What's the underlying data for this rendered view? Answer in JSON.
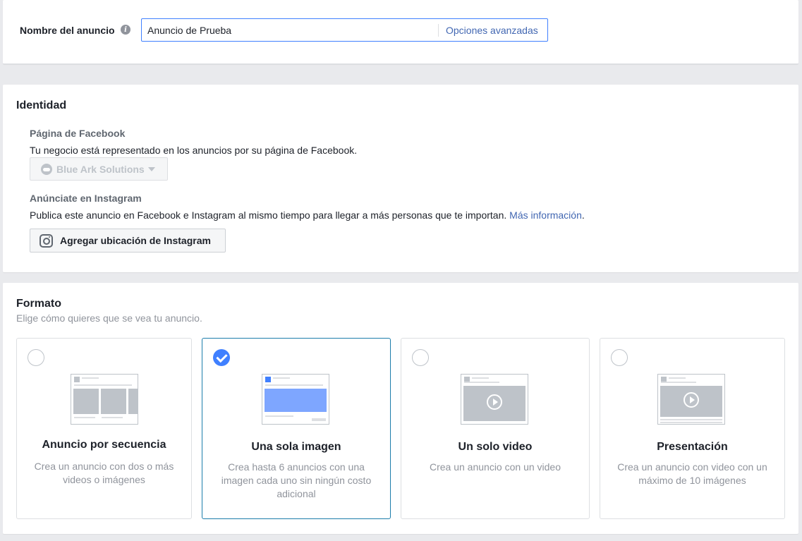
{
  "ad_name": {
    "label": "Nombre del anuncio",
    "value": "Anuncio de Prueba",
    "advanced_link": "Opciones avanzadas"
  },
  "identity": {
    "title": "Identidad",
    "facebook_page": {
      "title": "Página de Facebook",
      "description": "Tu negocio está representado en los anuncios por su página de Facebook.",
      "selected_page": "Blue Ark Solutions"
    },
    "instagram": {
      "title": "Anúnciate en Instagram",
      "description": "Publica este anuncio en Facebook e Instagram al mismo tiempo para llegar a más personas que te importan.",
      "more_info_link": "Más información",
      "more_info_suffix": ".",
      "button_label": "Agregar ubicación de Instagram"
    }
  },
  "format": {
    "title": "Formato",
    "description": "Elige cómo quieres que se vea tu anuncio.",
    "options": [
      {
        "id": "carousel",
        "title": "Anuncio por secuencia",
        "description": "Crea un anuncio con dos o más videos o imágenes",
        "selected": false
      },
      {
        "id": "single-image",
        "title": "Una sola imagen",
        "description": "Crea hasta 6 anuncios con una imagen cada uno sin ningún costo adicional",
        "selected": true
      },
      {
        "id": "single-video",
        "title": "Un solo video",
        "description": "Crea un anuncio con un video",
        "selected": false
      },
      {
        "id": "slideshow",
        "title": "Presentación",
        "description": "Crea un anuncio con video con un máximo de 10 imágenes",
        "selected": false
      }
    ]
  },
  "colors": {
    "accent_blue": "#4080ff",
    "link_blue": "#4267b2",
    "selected_border": "#1c7dab",
    "placeholder_gray": "#bec3c9"
  },
  "icons": {
    "info": "info-icon",
    "page": "cloud-icon",
    "dropdown": "caret-down-icon",
    "instagram": "instagram-icon",
    "checked": "checkmark-icon",
    "play": "play-icon"
  }
}
